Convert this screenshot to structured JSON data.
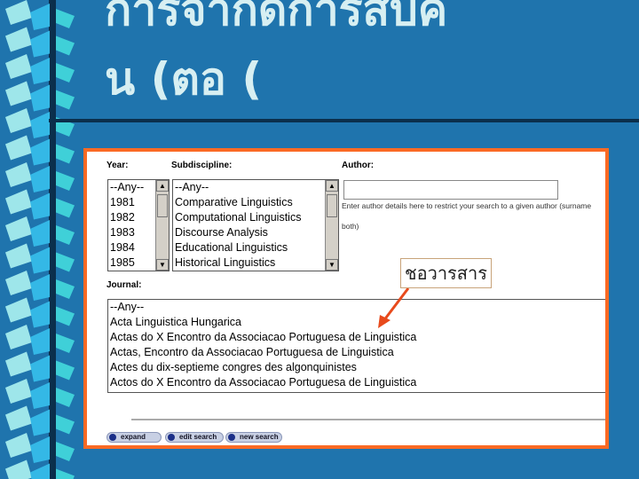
{
  "slide": {
    "title_line1": "การจำกัดการสืบค",
    "title_line2": "น (ตอ (",
    "colors": {
      "background": "#1f74ad",
      "title": "#d7eff2",
      "panel_border": "#fb6a24",
      "arrow": "#e84a1c"
    }
  },
  "form": {
    "year_label": "Year:",
    "year_options": [
      "--Any--",
      "1981",
      "1982",
      "1983",
      "1984",
      "1985"
    ],
    "subdiscipline_label": "Subdiscipline:",
    "subdiscipline_options": [
      "--Any--",
      "Comparative Linguistics",
      "Computational Linguistics",
      "Discourse Analysis",
      "Educational Linguistics",
      "Historical Linguistics"
    ],
    "author_label": "Author:",
    "author_value": "",
    "author_hint": "Enter author details here to restrict your search to a given author (surname",
    "author_hint2": "both)",
    "journal_label": "Journal:",
    "journal_options": [
      "--Any--",
      "Acta Linguistica Hungarica",
      "Actas do X Encontro da Associacao Portuguesa de Linguistica",
      "Actas, Encontro da Associacao Portuguesa de Linguistica",
      "Actes du dix-septieme congres des algonquinistes",
      "Actos do X Encontro da Associacao Portuguesa de Linguistica"
    ],
    "buttons": {
      "expand": "expand",
      "edit_search": "edit search",
      "new_search": "new search"
    }
  },
  "callout": {
    "text": "ชอวารสาร"
  }
}
